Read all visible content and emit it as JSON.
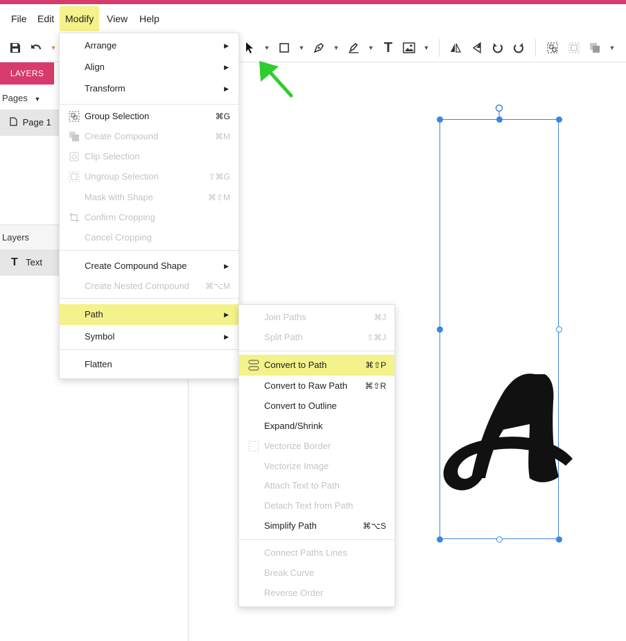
{
  "menubar": {
    "file": "File",
    "edit": "Edit",
    "modify": "Modify",
    "view": "View",
    "help": "Help"
  },
  "toolbar": {
    "icons": [
      "save-icon",
      "undo-icon",
      "select-arrow-icon",
      "rectangle-icon",
      "pen-icon",
      "pencil-icon",
      "text-icon",
      "image-icon",
      "flip-horizontal-icon",
      "flip-vertical-icon",
      "rotate-left-icon",
      "rotate-right-icon",
      "group-icon",
      "ungroup-icon",
      "combine-icon"
    ]
  },
  "left_panel": {
    "layers_tab": "LAYERS",
    "pages_header": "Pages",
    "page_item": "Page 1",
    "layers_header": "Layers",
    "layer_item": "Text"
  },
  "modify_menu": {
    "items": [
      {
        "label": "Arrange",
        "submenu": true
      },
      {
        "label": "Align",
        "submenu": true
      },
      {
        "label": "Transform",
        "submenu": true
      },
      {
        "label": "Group Selection",
        "shortcut": "⌘G"
      },
      {
        "label": "Create Compound",
        "shortcut": "⌘M",
        "disabled": true
      },
      {
        "label": "Clip Selection",
        "disabled": true
      },
      {
        "label": "Ungroup Selection",
        "shortcut": "⇧⌘G",
        "disabled": true
      },
      {
        "label": "Mask with Shape",
        "shortcut": "⌘⇧M",
        "disabled": true
      },
      {
        "label": "Confirm Cropping",
        "disabled": true
      },
      {
        "label": "Cancel Cropping",
        "disabled": true
      },
      {
        "label": "Create Compound Shape",
        "submenu": true
      },
      {
        "label": "Create Nested Compound",
        "shortcut": "⌘⌥M",
        "disabled": true
      },
      {
        "label": "Path",
        "submenu": true,
        "highlighted": true
      },
      {
        "label": "Symbol",
        "submenu": true
      },
      {
        "label": "Flatten"
      }
    ]
  },
  "path_submenu": {
    "items": [
      {
        "label": "Join Paths",
        "shortcut": "⌘J",
        "disabled": true
      },
      {
        "label": "Split Path",
        "shortcut": "⇧⌘J",
        "disabled": true
      },
      {
        "label": "Convert to Path",
        "shortcut": "⌘⇧P",
        "highlighted": true
      },
      {
        "label": "Convert to Raw Path",
        "shortcut": "⌘⇧R"
      },
      {
        "label": "Convert to Outline"
      },
      {
        "label": "Expand/Shrink"
      },
      {
        "label": "Vectorize Border",
        "disabled": true
      },
      {
        "label": "Vectorize Image",
        "disabled": true
      },
      {
        "label": "Attach Text to Path",
        "disabled": true
      },
      {
        "label": "Detach Text from Path",
        "disabled": true
      },
      {
        "label": "Simplify Path",
        "shortcut": "⌘⌥S"
      },
      {
        "label": "Connect Paths Lines",
        "disabled": true
      },
      {
        "label": "Break Curve",
        "disabled": true
      },
      {
        "label": "Reverse Order",
        "disabled": true
      }
    ]
  },
  "canvas": {
    "glyph": "A"
  },
  "colors": {
    "accent": "#d83a6b",
    "highlight": "#f4f28a",
    "selection": "#3a86e0",
    "annotation_arrow": "#2ecc2e"
  }
}
